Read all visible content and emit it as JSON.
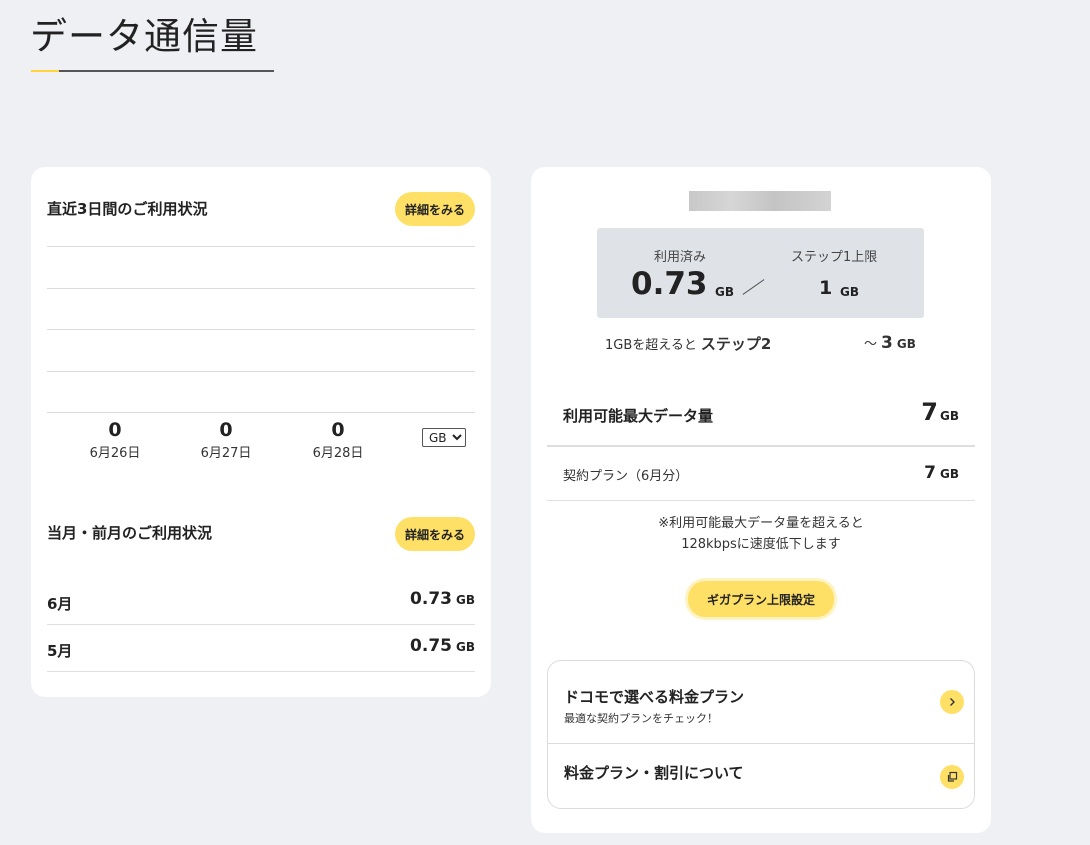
{
  "page": {
    "title": "データ通信量"
  },
  "recent": {
    "title": "直近3日間のご利用状況",
    "details_label": "詳細をみる",
    "days": [
      {
        "value": "0",
        "date": "6月26日"
      },
      {
        "value": "0",
        "date": "6月27日"
      },
      {
        "value": "0",
        "date": "6月28日"
      }
    ],
    "unit_selected": "GB"
  },
  "monthly": {
    "title": "当月・前月のご利用状況",
    "details_label": "詳細をみる",
    "rows": [
      {
        "month": "6月",
        "amount": "0.73",
        "unit": "GB"
      },
      {
        "month": "5月",
        "amount": "0.75",
        "unit": "GB"
      }
    ]
  },
  "usage": {
    "used_label": "利用済み",
    "used_value": "0.73",
    "used_unit": "GB",
    "limit_label": "ステップ1上限",
    "limit_value": "1",
    "limit_unit": "GB",
    "step_note_prefix": "1GBを超えると",
    "step_note_step": "ステップ2",
    "step_range_prefix": "～",
    "step_range_value": "3",
    "step_range_unit": "GB"
  },
  "max_data": {
    "label": "利用可能最大データ量",
    "value": "7",
    "unit": "GB"
  },
  "plan": {
    "label": "契約プラン（6月分）",
    "value": "7",
    "unit": "GB"
  },
  "notice": {
    "line1": "※利用可能最大データ量を超えると",
    "line2": "128kbpsに速度低下します"
  },
  "giga_button": {
    "label": "ギガプラン上限設定"
  },
  "links": [
    {
      "title": "ドコモで選べる料金プラン",
      "subtitle": "最適な契約プランをチェック！",
      "icon": "chevron-right-icon"
    },
    {
      "title": "料金プラン・割引について",
      "icon": "external-window-icon"
    }
  ],
  "colors": {
    "accent": "#ffe066",
    "background": "#eef0f3",
    "usage_box": "#dfe3e8"
  }
}
